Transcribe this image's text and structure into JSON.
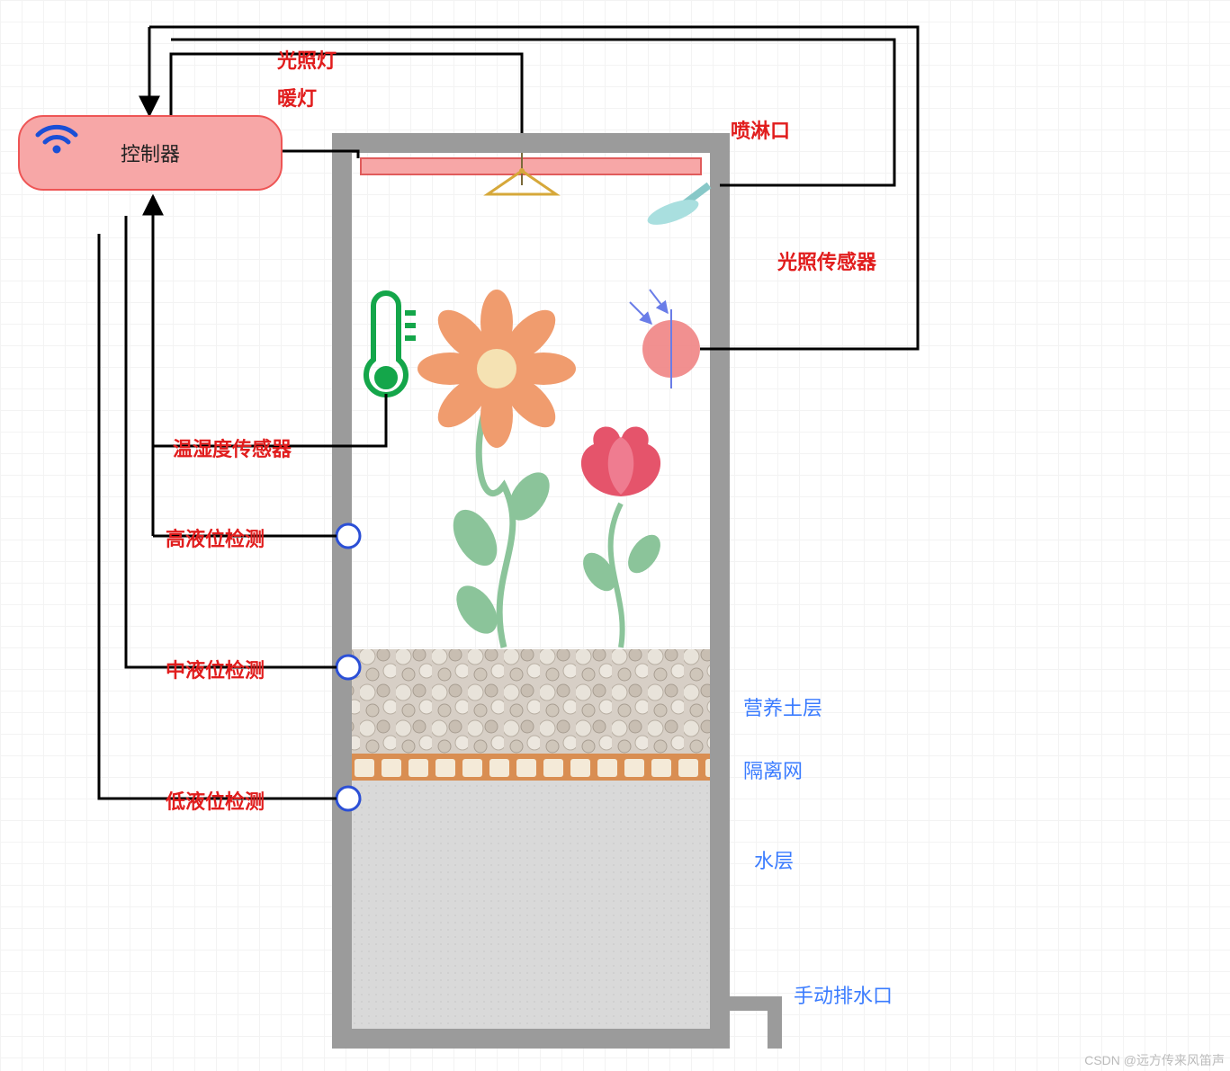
{
  "controller": "控制器",
  "labels": {
    "light_lamp": "光照灯",
    "warm_lamp": "暖灯",
    "sprinkler": "喷淋口",
    "light_sensor": "光照传感器",
    "temp_humid_sensor": "温湿度传感器",
    "high_level": "高液位检测",
    "mid_level": "中液位检测",
    "low_level": "低液位检测",
    "soil_layer": "营养土层",
    "isolation_net": "隔离网",
    "water_layer": "水层",
    "drain": "手动排水口"
  },
  "watermark": "CSDN @远方传来风笛声",
  "colors": {
    "accent_red": "#e11d1d",
    "accent_blue": "#3b7cff",
    "box_pink": "#f7a7a7",
    "plant_green": "#8bc49a",
    "flower_orange": "#f09c6e",
    "flower_red": "#e5546b",
    "temp_green": "#14a64a",
    "shower_teal": "#a9dfdf",
    "wall_gray": "#9b9b9b"
  }
}
